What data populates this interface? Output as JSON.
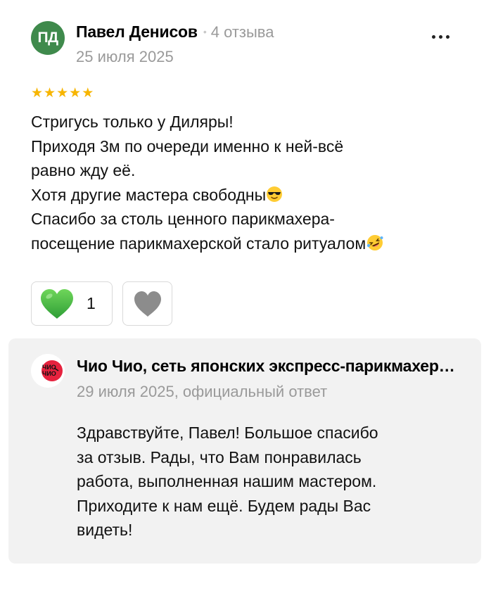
{
  "review": {
    "author": {
      "initials": "ПД",
      "name": "Павел Денисов",
      "separator": "•",
      "reviews_count": "4 отзыва",
      "avatar_color": "#3f8a4c"
    },
    "date": "25 июля 2025",
    "rating": 5,
    "star_color": "#f7b500",
    "text_lines": [
      "Стригусь только у Диляры!",
      "Приходя 3м по очереди именно к ней-всё",
      "равно жду её.",
      "Хотя другие мастера свободны",
      "Спасибо за столь ценного парикмахера-",
      "посещение парикмахерской стало ритуалом"
    ],
    "emojis": {
      "line4": "smiling-face-with-sunglasses-icon",
      "line6": "rolling-on-floor-laughing-icon"
    },
    "reactions": {
      "likes": "1",
      "like_color": "#3cb043",
      "dislike_color": "#8c8c8c"
    }
  },
  "reply": {
    "org_logo_text": [
      "ЧИО",
      "ЧИО"
    ],
    "org_name": "Чио Чио, сеть японских экспресс-парикмахерских",
    "meta": "29 июля 2025, официальный ответ",
    "text_lines": [
      "Здравствуйте, Павел! Большое спасибо",
      "за отзыв. Рады, что Вам понравилась",
      "работа, выполненная нашим мастером.",
      "Приходите к нам ещё. Будем рады Вас",
      "видеть!"
    ],
    "background": "#f2f2f2",
    "accent": "#e6223e"
  }
}
